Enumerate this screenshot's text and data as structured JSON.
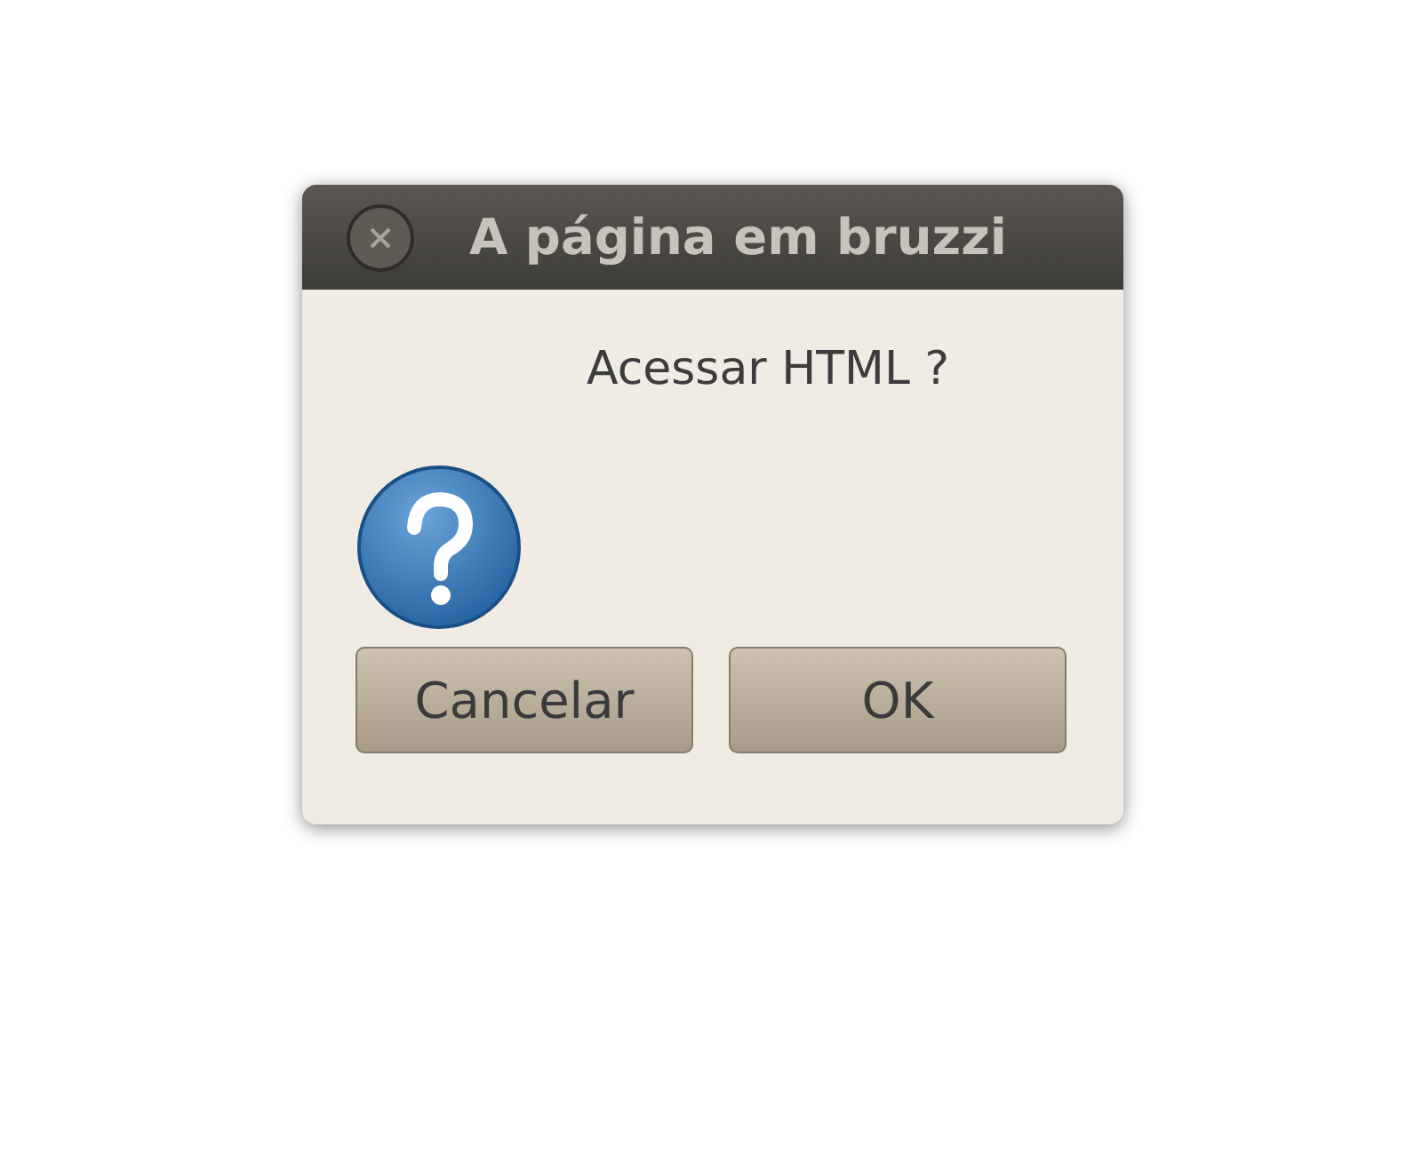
{
  "dialog": {
    "title": "A página em bruzzi",
    "message": "Acessar HTML ?"
  },
  "buttons": [
    "Cancelar",
    "OK"
  ]
}
